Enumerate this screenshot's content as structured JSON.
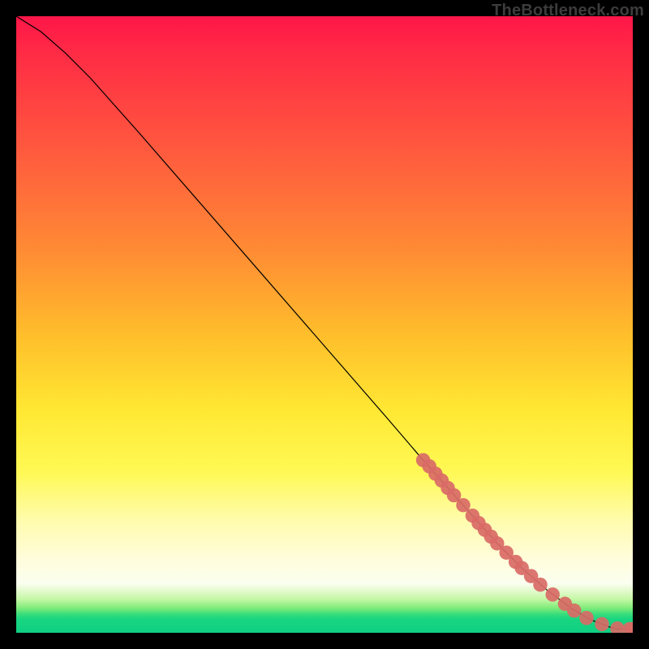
{
  "watermark": "TheBottleneck.com",
  "chart_data": {
    "type": "line",
    "title": "",
    "xlabel": "",
    "ylabel": "",
    "xlim": [
      0,
      100
    ],
    "ylim": [
      0,
      100
    ],
    "grid": false,
    "legend": false,
    "line_color": "#000000",
    "marker_color": "#d96a66",
    "line": {
      "x": [
        0,
        4,
        8,
        12,
        20,
        30,
        40,
        50,
        60,
        66,
        70,
        74,
        78,
        82,
        86,
        90,
        93,
        96,
        97.5,
        100
      ],
      "y": [
        100,
        97.5,
        94,
        90,
        81,
        69.5,
        58,
        46.5,
        35,
        28,
        23.5,
        19,
        14.5,
        10.5,
        7,
        4,
        2.2,
        1,
        0.6,
        0.6
      ]
    },
    "markers": [
      {
        "x": 66,
        "y": 28
      },
      {
        "x": 67,
        "y": 27
      },
      {
        "x": 68,
        "y": 25.8
      },
      {
        "x": 69,
        "y": 24.7
      },
      {
        "x": 70,
        "y": 23.5
      },
      {
        "x": 71,
        "y": 22.3
      },
      {
        "x": 72.5,
        "y": 20.7
      },
      {
        "x": 74,
        "y": 19
      },
      {
        "x": 75,
        "y": 17.8
      },
      {
        "x": 76,
        "y": 16.7
      },
      {
        "x": 77,
        "y": 15.6
      },
      {
        "x": 78,
        "y": 14.5
      },
      {
        "x": 79.5,
        "y": 13
      },
      {
        "x": 81,
        "y": 11.5
      },
      {
        "x": 82,
        "y": 10.5
      },
      {
        "x": 83.5,
        "y": 9.2
      },
      {
        "x": 85,
        "y": 7.8
      },
      {
        "x": 87,
        "y": 6.2
      },
      {
        "x": 89,
        "y": 4.7
      },
      {
        "x": 90.5,
        "y": 3.6
      },
      {
        "x": 92.5,
        "y": 2.4
      },
      {
        "x": 95,
        "y": 1.4
      },
      {
        "x": 97.5,
        "y": 0.7
      },
      {
        "x": 99.5,
        "y": 0.6
      },
      {
        "x": 100,
        "y": 0.6
      }
    ]
  }
}
